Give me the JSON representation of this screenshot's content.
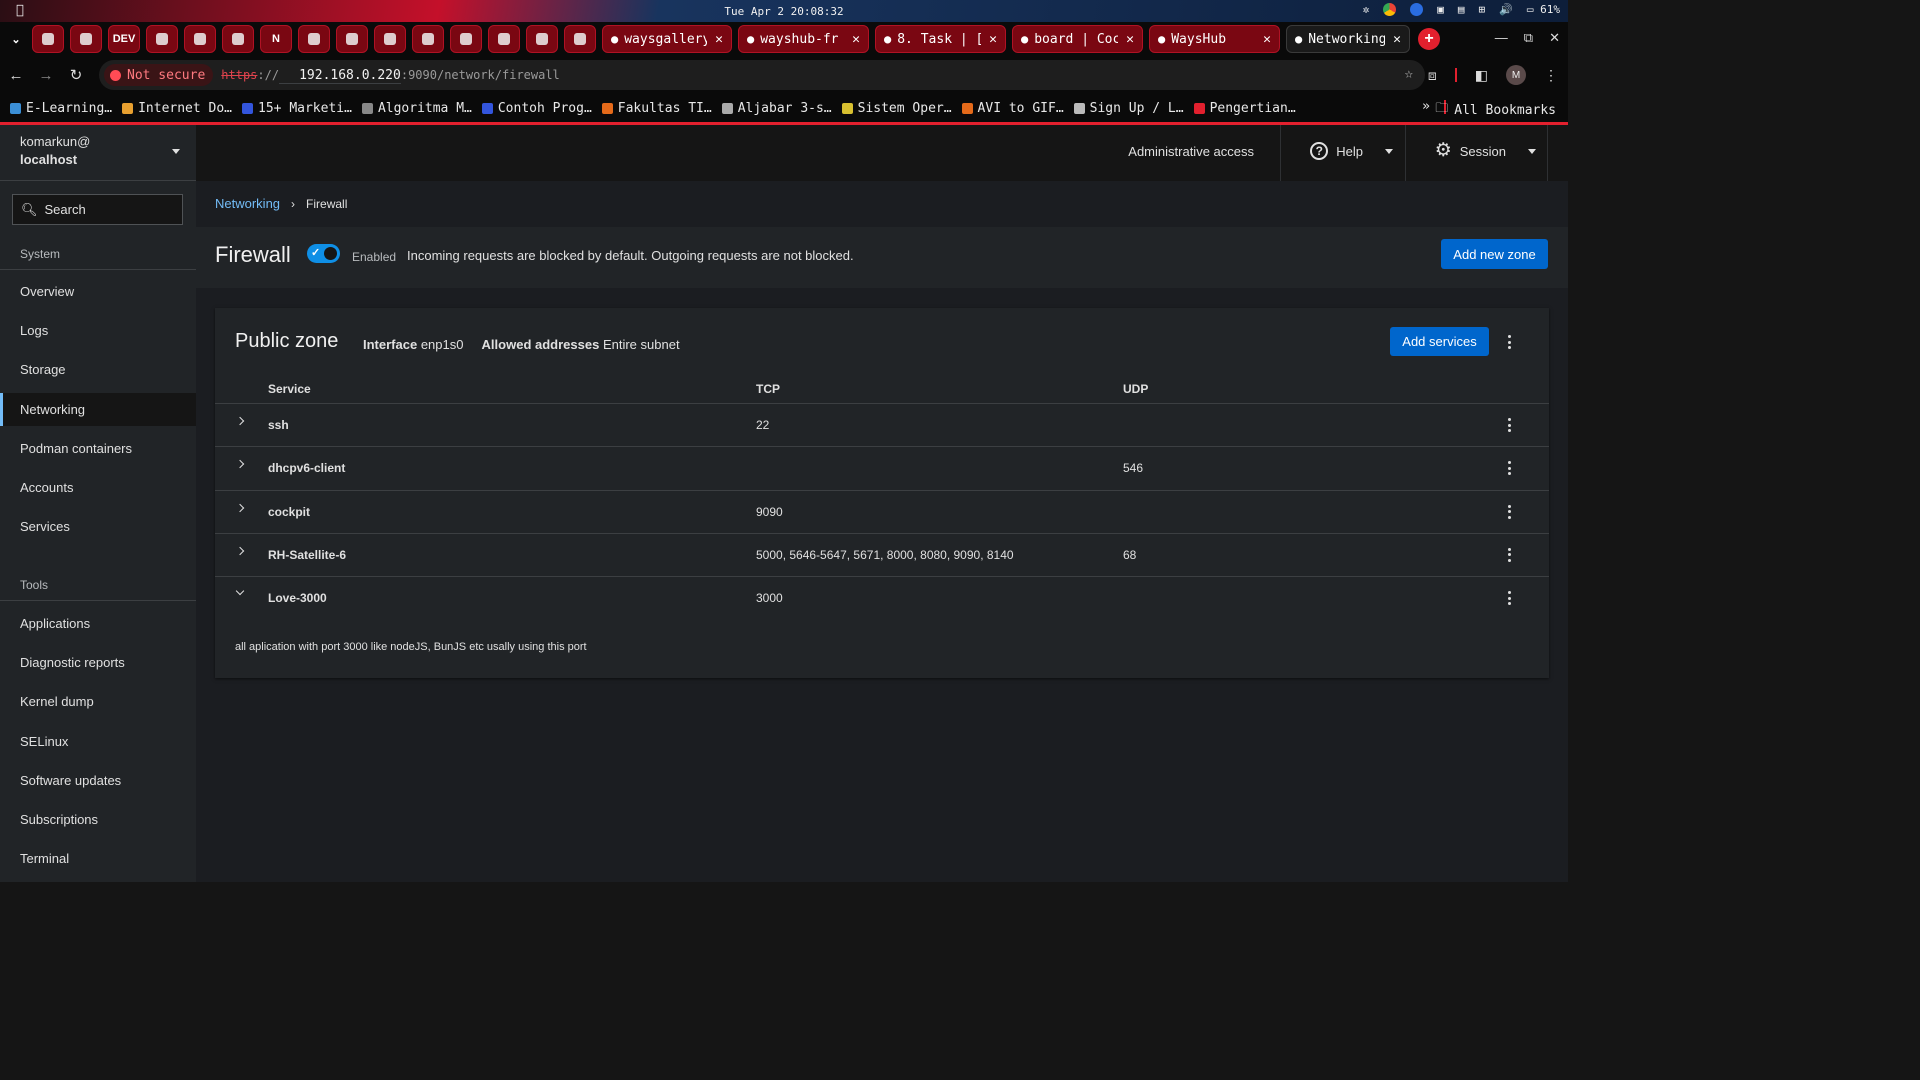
{
  "os_bar": {
    "clock": "Tue Apr 2 20:08:32",
    "battery": "61%"
  },
  "browser": {
    "mini_tabs": [
      {
        "icon": "github-icon",
        "label": ""
      },
      {
        "icon": "flame-icon",
        "label": ""
      },
      {
        "icon": "dev-icon",
        "label": "DEV"
      },
      {
        "icon": "gmail-icon",
        "label": ""
      },
      {
        "icon": "drive-icon",
        "label": ""
      },
      {
        "icon": "dumbways-icon",
        "label": ""
      },
      {
        "icon": "notion-icon",
        "label": "N"
      },
      {
        "icon": "youtube-icon",
        "label": ""
      },
      {
        "icon": "youtube-icon",
        "label": ""
      },
      {
        "icon": "youtube-icon",
        "label": ""
      },
      {
        "icon": "arch-icon",
        "label": ""
      },
      {
        "icon": "github-icon",
        "label": ""
      },
      {
        "icon": "github-icon",
        "label": ""
      },
      {
        "icon": "dumbways-icon",
        "label": ""
      },
      {
        "icon": "dumbways-icon",
        "label": ""
      }
    ],
    "wide_tabs": [
      {
        "label": "waysgallery",
        "active": false
      },
      {
        "label": "wayshub-fr",
        "active": false
      },
      {
        "label": "8. Task | [",
        "active": false
      },
      {
        "label": "board | Coc",
        "active": false
      },
      {
        "label": "WaysHub",
        "active": false
      },
      {
        "label": "Networking",
        "active": true
      }
    ],
    "not_secure": "Not secure",
    "url_scheme": "https",
    "url_sep": "://",
    "url_host": "192.168.0.220",
    "url_rest": ":9090/network/firewall",
    "avatar": "M",
    "bookmarks": [
      {
        "label": "E-Learning…",
        "color": "#3b8fd6"
      },
      {
        "label": "Internet Do…",
        "color": "#e8a030"
      },
      {
        "label": "15+ Marketi…",
        "color": "#3355dd"
      },
      {
        "label": "Algoritma M…",
        "color": "#888888"
      },
      {
        "label": "Contoh Prog…",
        "color": "#3355dd"
      },
      {
        "label": "Fakultas TI…",
        "color": "#e56a1a"
      },
      {
        "label": "Aljabar 3-s…",
        "color": "#aaaaaa"
      },
      {
        "label": "Sistem Oper…",
        "color": "#d8c030"
      },
      {
        "label": "AVI to GIF…",
        "color": "#e56a1a"
      },
      {
        "label": "Sign Up / L…",
        "color": "#bbbbbb"
      },
      {
        "label": "Pengertian…",
        "color": "#e2202e"
      }
    ],
    "bookmarks_more": "»",
    "all_bookmarks": "All Bookmarks"
  },
  "sidebar": {
    "user": "komarkun@",
    "host": "localhost",
    "search_placeholder": "Search",
    "system_label": "System",
    "system_items": [
      "Overview",
      "Logs",
      "Storage",
      "Networking",
      "Podman containers",
      "Accounts",
      "Services"
    ],
    "tools_label": "Tools",
    "tools_items": [
      "Applications",
      "Diagnostic reports",
      "Kernel dump",
      "SELinux",
      "Software updates",
      "Subscriptions",
      "Terminal"
    ],
    "active_item": "Networking"
  },
  "masthead": {
    "admin": "Administrative access",
    "help": "Help",
    "session": "Session"
  },
  "breadcrumb": {
    "parent": "Networking",
    "current": "Firewall"
  },
  "firewall": {
    "title": "Firewall",
    "status": "Enabled",
    "description": "Incoming requests are blocked by default. Outgoing requests are not blocked.",
    "add_zone": "Add new zone"
  },
  "zone": {
    "title": "Public zone",
    "interface_label": "Interface",
    "interface_value": "enp1s0",
    "addresses_label": "Allowed addresses",
    "addresses_value": "Entire subnet",
    "add_services": "Add services",
    "columns": [
      "Service",
      "TCP",
      "UDP"
    ],
    "rows": [
      {
        "service": "ssh",
        "tcp": "22",
        "udp": "",
        "expanded": false
      },
      {
        "service": "dhcpv6-client",
        "tcp": "",
        "udp": "546",
        "expanded": false
      },
      {
        "service": "cockpit",
        "tcp": "9090",
        "udp": "",
        "expanded": false
      },
      {
        "service": "RH-Satellite-6",
        "tcp": "5000, 5646-5647, 5671, 8000, 8080, 9090, 8140",
        "udp": "68",
        "expanded": false
      },
      {
        "service": "Love-3000",
        "tcp": "3000",
        "udp": "",
        "expanded": true
      }
    ],
    "expanded_text": "all aplication with port 3000 like nodeJS, BunJS etc usally using this port"
  },
  "colors": {
    "accent_link": "#73bcf7",
    "primary_button": "#0066cc",
    "browser_red": "#e2202e"
  }
}
